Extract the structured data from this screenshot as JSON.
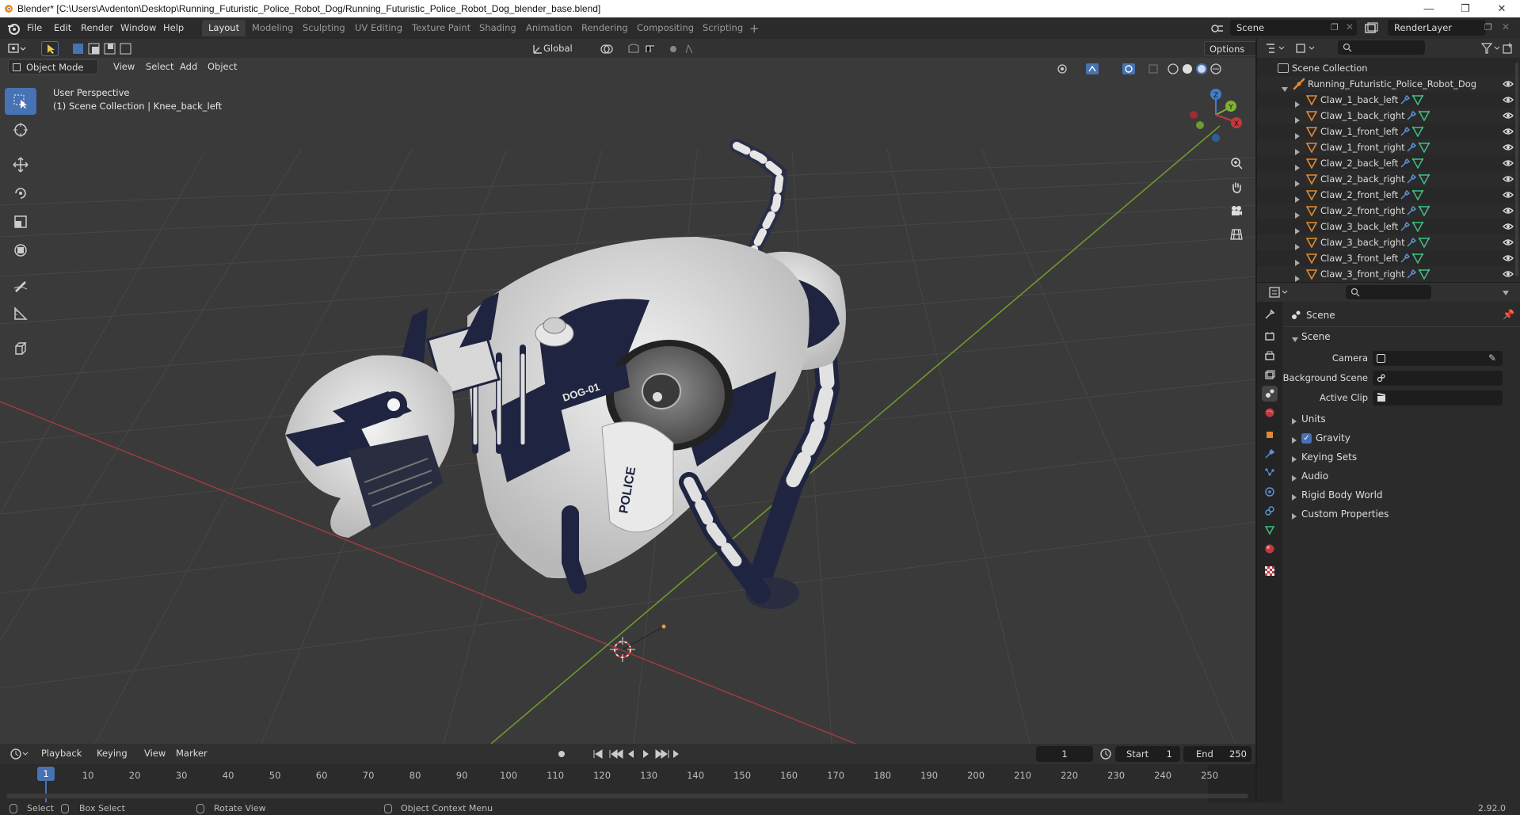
{
  "window": {
    "title": "Blender* [C:\\Users\\Avdenton\\Desktop\\Running_Futuristic_Police_Robot_Dog/Running_Futuristic_Police_Robot_Dog_blender_base.blend]",
    "controls": [
      "—",
      "❐",
      "✕"
    ]
  },
  "menu": [
    "File",
    "Edit",
    "Render",
    "Window",
    "Help"
  ],
  "workspaces": [
    {
      "label": "Layout",
      "active": true
    },
    {
      "label": "Modeling"
    },
    {
      "label": "Sculpting"
    },
    {
      "label": "UV Editing"
    },
    {
      "label": "Texture Paint"
    },
    {
      "label": "Shading"
    },
    {
      "label": "Animation"
    },
    {
      "label": "Rendering"
    },
    {
      "label": "Compositing"
    },
    {
      "label": "Scripting"
    }
  ],
  "scene_field": "Scene",
  "renderlayer_field": "RenderLayer",
  "viewport": {
    "mode": "Object Mode",
    "menus": [
      "View",
      "Select",
      "Add",
      "Object"
    ],
    "orientation": "Global",
    "options": "Options",
    "perspective": "User Perspective",
    "collection_info": "(1) Scene Collection | Knee_back_left",
    "gizmo_axes": {
      "z": "Z",
      "y": "Y",
      "x": "X"
    },
    "model_label": "DOG-01",
    "model_text": "POLICE"
  },
  "timeline": {
    "menus": [
      "Playback",
      "Keying",
      "View",
      "Marker"
    ],
    "current_frame": "1",
    "start_label": "Start",
    "start": "1",
    "end_label": "End",
    "end": "250",
    "ticks": [
      "1",
      "10",
      "20",
      "30",
      "40",
      "50",
      "60",
      "70",
      "80",
      "90",
      "100",
      "110",
      "120",
      "130",
      "140",
      "150",
      "160",
      "170",
      "180",
      "190",
      "200",
      "210",
      "220",
      "230",
      "240",
      "250"
    ]
  },
  "statusbar": {
    "select": "Select",
    "box_select": "Box Select",
    "rotate_view": "Rotate View",
    "context_menu": "Object Context Menu",
    "version": "2.92.0"
  },
  "outliner": {
    "root": "Scene Collection",
    "collection": "Running_Futuristic_Police_Robot_Dog",
    "objects": [
      "Claw_1_back_left",
      "Claw_1_back_right",
      "Claw_1_front_left",
      "Claw_1_front_right",
      "Claw_2_back_left",
      "Claw_2_back_right",
      "Claw_2_front_left",
      "Claw_2_front_right",
      "Claw_3_back_left",
      "Claw_3_back_right",
      "Claw_3_front_left",
      "Claw_3_front_right"
    ]
  },
  "properties": {
    "context": "Scene",
    "panel": "Scene",
    "fields": [
      {
        "label": "Camera"
      },
      {
        "label": "Background Scene"
      },
      {
        "label": "Active Clip"
      }
    ],
    "subpanels": [
      {
        "label": "Units"
      },
      {
        "label": "Gravity",
        "checkbox": true
      },
      {
        "label": "Keying Sets"
      },
      {
        "label": "Audio"
      },
      {
        "label": "Rigid Body World"
      },
      {
        "label": "Custom Properties"
      }
    ]
  },
  "colors": {
    "accent": "#4772b3",
    "x_axis": "#c0393f",
    "y_axis": "#7eb332",
    "z_axis": "#3f80c9",
    "collection_orange": "#e3892f"
  }
}
